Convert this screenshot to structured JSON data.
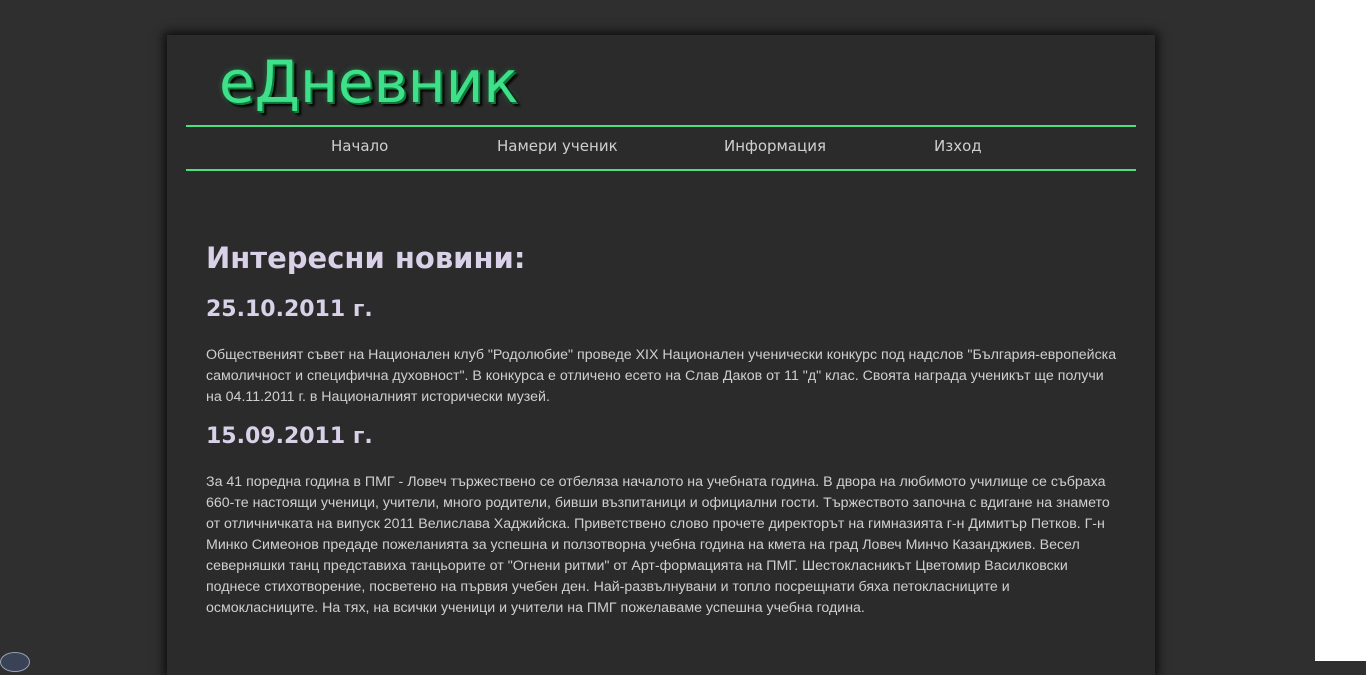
{
  "header": {
    "logo_text": "еДневник"
  },
  "nav": {
    "items": [
      {
        "label": "Начало"
      },
      {
        "label": "Намери ученик"
      },
      {
        "label": "Информация"
      },
      {
        "label": "Изход"
      }
    ]
  },
  "main": {
    "heading": "Интересни новини:",
    "news": [
      {
        "date": "25.10.2011 г.",
        "text": "Общественият съвет на Национален клуб \"Родолюбие\" проведе XIX Национален ученически конкурс под надслов \"България-европейска самоличност и специфична духовност\". В конкурса е отличено есето на Слав Даков от 11 \"д\" клас. Своята награда ученикът ще получи на 04.11.2011 г. в Националният исторически музей."
      },
      {
        "date": "15.09.2011 г.",
        "text": "За 41 поредна година в ПМГ - Ловеч тържествено се отбеляза началото на учебната година. В двора на любимото училище се събраха 660-те настоящи ученици, учители, много родители, бивши възпитаници и официални гости. Тържеството започна с вдигане на знамето от отличничката на випуск 2011 Велислава Хаджийска. Приветствено слово прочете директорът на гимназията г-н Димитър Петков. Г-н Минко Симеонов предаде пожеланията за успешна и ползотворна учебна година на кмета на град Ловеч Минчо Казанджиев. Весел северняшки танц представиха танцьорите от \"Огнени ритми\" от Арт-формацията на ПМГ. Шестокласникът Цветомир Василковски поднесе стихотворение, посветено на първия учебен ден. Най-развълнувани и топло посрещнати бяха петокласниците и осмокласниците. На тях, на всички ученици и учители на ПМГ пожелаваме успешна учебна година."
      }
    ]
  },
  "colors": {
    "background": "#2f2f2f",
    "panel": "#2b2b2b",
    "accent_green": "#4ae07f",
    "heading_text": "#d9d1e8",
    "body_text": "#cfcfcf"
  }
}
